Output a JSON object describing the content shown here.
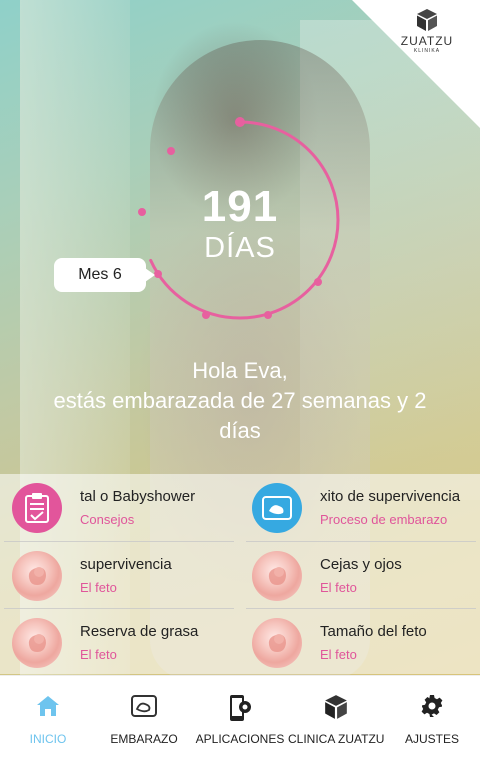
{
  "brand": {
    "name": "ZUATZU",
    "sub": "KLINIKA",
    "logo_icon": "cube-icon"
  },
  "counter": {
    "days": "191",
    "days_label": "DÍAS",
    "month_label": "Mes 6",
    "progress": 0.68,
    "accent": "#e7609f"
  },
  "greeting": {
    "line1": "Hola Eva,",
    "line2": "estás embarazada de 27 semanas y 2",
    "line3": "días"
  },
  "cards": [
    {
      "title": "tal o Babyshower",
      "category": "Consejos",
      "icon": "clipboard-check-icon"
    },
    {
      "title": "xito de supervivencia",
      "category": "Proceso de embarazo",
      "icon": "ultrasound-icon"
    },
    {
      "title": "supervivencia",
      "category": "El feto",
      "icon": "fetus-icon"
    },
    {
      "title": "Cejas y ojos",
      "category": "El feto",
      "icon": "fetus-icon"
    },
    {
      "title": "Reserva de grasa",
      "category": "El feto",
      "icon": "fetus-icon"
    },
    {
      "title": "Tamaño del feto",
      "category": "El feto",
      "icon": "fetus-icon"
    }
  ],
  "nav": [
    {
      "label": "INICIO",
      "icon": "home-icon",
      "active": true
    },
    {
      "label": "EMBARAZO",
      "icon": "ultrasound-icon",
      "active": false
    },
    {
      "label": "APLICACIONES",
      "icon": "phone-settings-icon",
      "active": false
    },
    {
      "label": "CLINICA ZUATZU",
      "icon": "cube-icon",
      "active": false
    },
    {
      "label": "AJUSTES",
      "icon": "gear-icon",
      "active": false
    }
  ],
  "colors": {
    "pink": "#e2559b",
    "blue": "#36a9e1",
    "nav_active": "#6ec4ee",
    "category": "#e0559a"
  }
}
